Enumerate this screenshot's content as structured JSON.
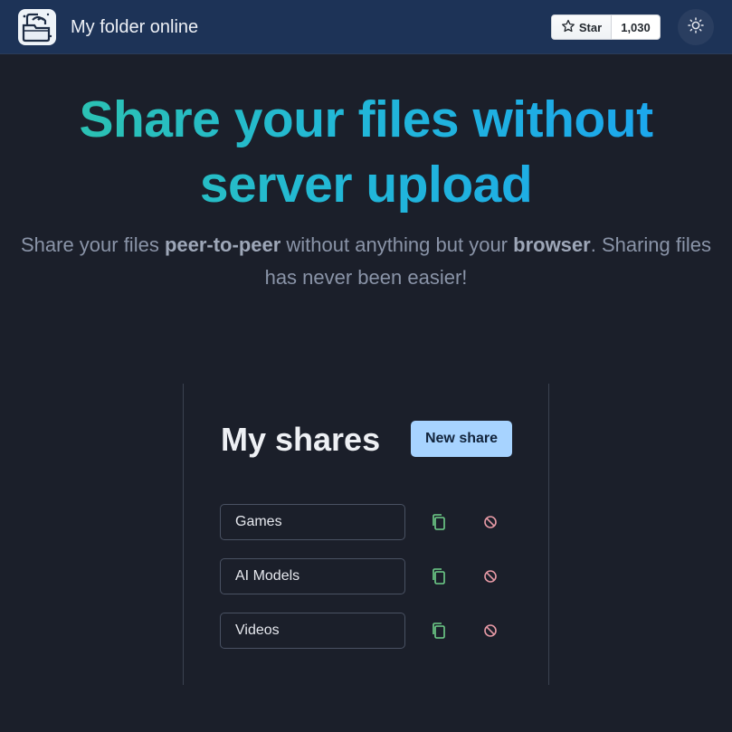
{
  "app": {
    "title": "My folder online"
  },
  "github": {
    "star_label": "Star",
    "star_count": "1,030",
    "star_icon": "star-icon"
  },
  "theme_toggle": {
    "icon": "sun-icon"
  },
  "hero": {
    "title_line1": "Share your files without",
    "title_line2": "server upload",
    "subtitle_pre": "Share your files ",
    "subtitle_bold1": "peer-to-peer",
    "subtitle_mid": " without anything but your ",
    "subtitle_bold2": "browser",
    "subtitle_post": ". Sharing files has never been easier!"
  },
  "shares": {
    "title": "My shares",
    "new_share_label": "New share",
    "items": [
      {
        "name": "Games"
      },
      {
        "name": "AI Models"
      },
      {
        "name": "Videos"
      }
    ]
  },
  "colors": {
    "background": "#1b1f2a",
    "navbar": "#1d3357",
    "accent_button": "#a7d3ff",
    "copy_icon": "#6fcf8a",
    "revoke_icon": "#e89aa6",
    "title_gradient_start": "#2ec4a8",
    "title_gradient_end": "#1aa3f2"
  }
}
